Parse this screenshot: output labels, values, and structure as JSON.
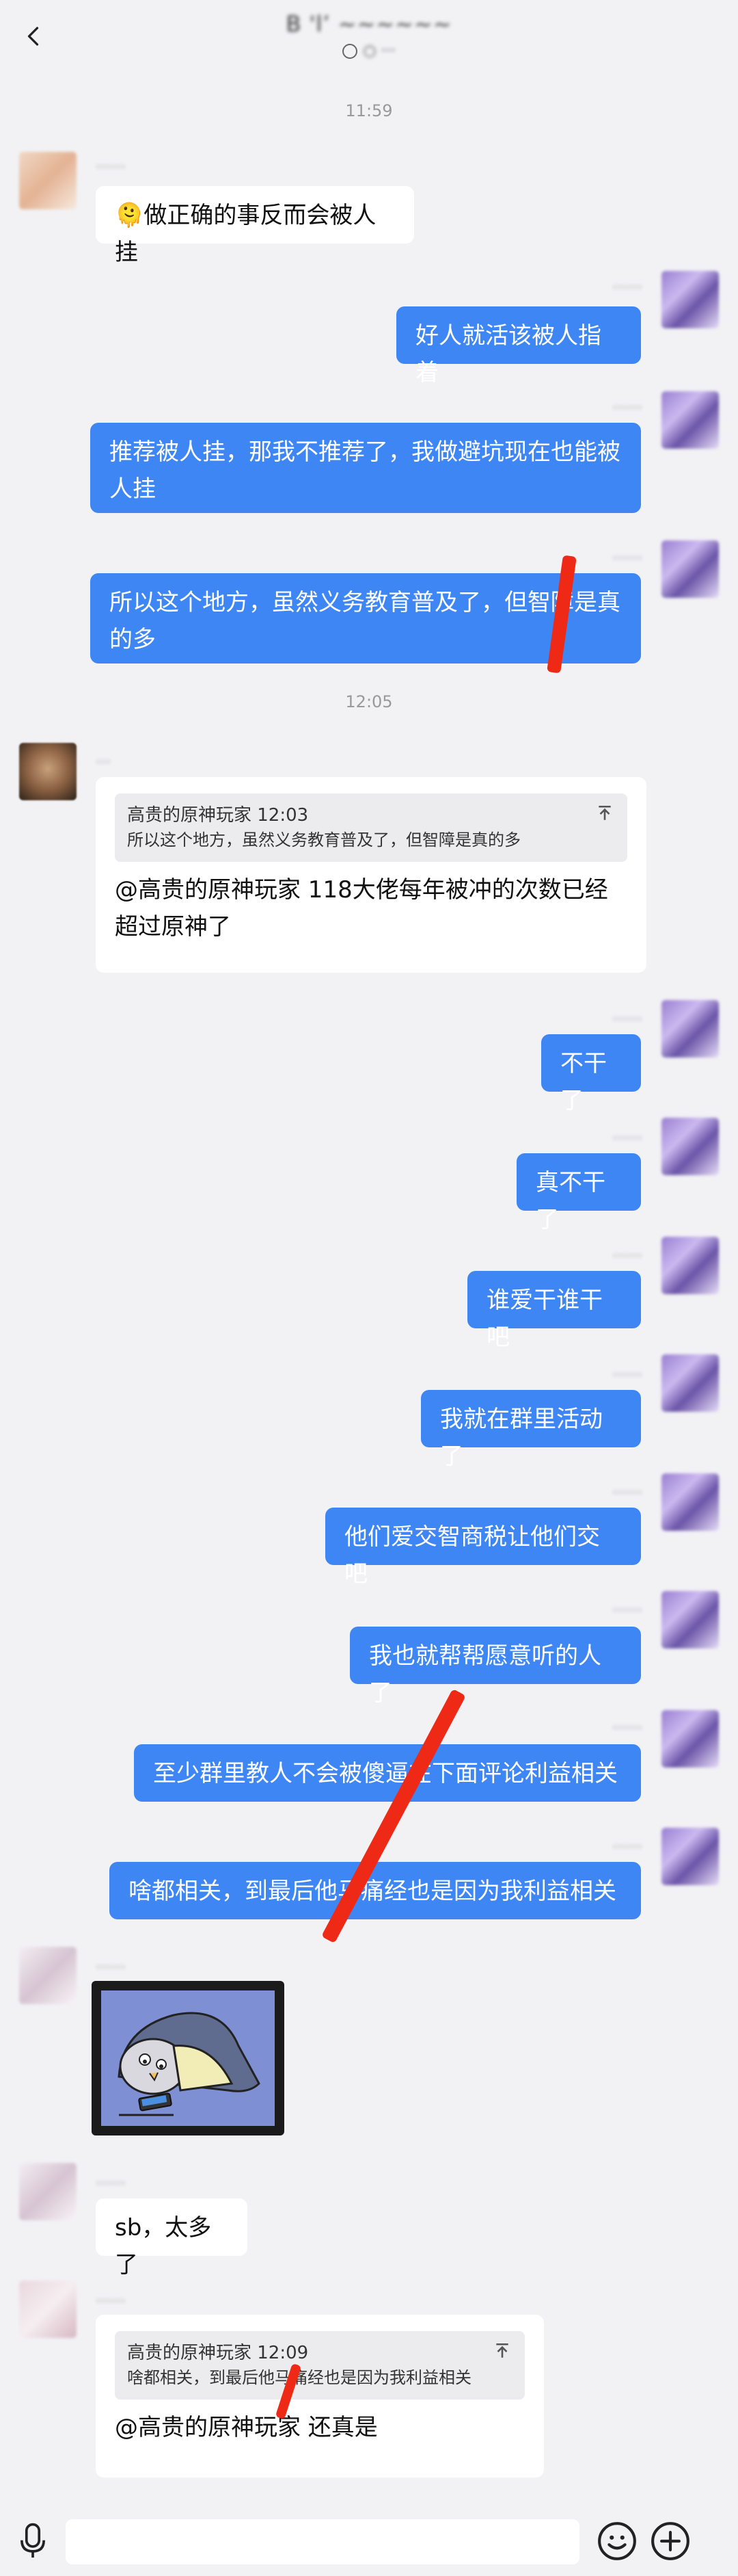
{
  "header": {
    "back_label": "<",
    "title": "B 'l’ ~~~~~~ ",
    "subtitle": "○ ···"
  },
  "timestamps": [
    "11:59",
    "12:05"
  ],
  "messages": [
    {
      "id": "m1",
      "side": "left",
      "avatar": "av-a",
      "name": "……",
      "text": "🫠做正确的事反而会被人挂"
    },
    {
      "id": "m2",
      "side": "right",
      "name": "……",
      "text": "好人就活该被人指着"
    },
    {
      "id": "m3",
      "side": "right",
      "name": "……",
      "text": "推荐被人挂，那我不推荐了，我做避坑现在也能被人挂"
    },
    {
      "id": "m4",
      "side": "right",
      "name": "……",
      "text": "所以这个地方，虽然义务教育普及了，但智障是真的多"
    },
    {
      "id": "m5",
      "side": "left",
      "avatar": "av-b",
      "name": "…",
      "quote_head": "高贵的原神玩家 12:03",
      "quote_body": "所以这个地方，虽然义务教育普及了，但智障是真的多",
      "text": "@高贵的原神玩家 118大佬每年被冲的次数已经超过原神了"
    },
    {
      "id": "m6",
      "side": "right",
      "name": "……",
      "text": "不干了"
    },
    {
      "id": "m7",
      "side": "right",
      "name": "……",
      "text": "真不干了"
    },
    {
      "id": "m8",
      "side": "right",
      "name": "……",
      "text": "谁爱干谁干吧"
    },
    {
      "id": "m9",
      "side": "right",
      "name": "……",
      "text": "我就在群里活动了"
    },
    {
      "id": "m10",
      "side": "right",
      "name": "……",
      "text": "他们爱交智商税让他们交吧"
    },
    {
      "id": "m11",
      "side": "right",
      "name": "……",
      "text": "我也就帮帮愿意听的人了"
    },
    {
      "id": "m12",
      "side": "right",
      "name": "……",
      "text": "至少群里教人不会被傻逼在下面评论利益相关"
    },
    {
      "id": "m13",
      "side": "right",
      "name": "……",
      "text": "啥都相关，到最后他马痛经也是因为我利益相关"
    },
    {
      "id": "m14",
      "side": "left",
      "avatar": "av-c",
      "name": "……",
      "sticker": "sticker"
    },
    {
      "id": "m15",
      "side": "left",
      "avatar": "av-c",
      "name": "……",
      "text": "sb，太多了"
    },
    {
      "id": "m16",
      "side": "left",
      "avatar": "av-d",
      "name": "……",
      "quote_head": "高贵的原神玩家 12:09",
      "quote_body": "啥都相关，到最后他马痛经也是因为我利益相关",
      "text": "@高贵的原神玩家 还真是"
    }
  ],
  "inputbar": {
    "placeholder": "",
    "icons": [
      "mic-icon",
      "emoji-icon",
      "plus-icon"
    ]
  },
  "colors": {
    "me_bubble": "#3d86f3",
    "background": "#f2f2f5",
    "redline": "#ee2a17"
  }
}
